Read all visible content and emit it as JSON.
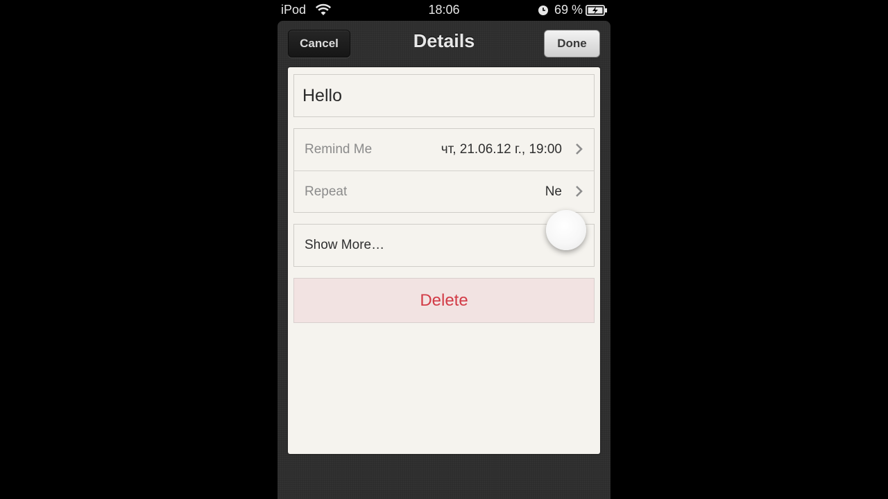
{
  "status_bar": {
    "carrier": "iPod",
    "time": "18:06",
    "battery": "69 %"
  },
  "nav": {
    "title": "Details",
    "cancel_label": "Cancel",
    "done_label": "Done"
  },
  "reminder": {
    "title": "Hello",
    "rows": [
      {
        "label": "Remind Me",
        "value": "чт, 21.06.12 г., 19:00"
      },
      {
        "label": "Repeat",
        "value": "Ne"
      }
    ],
    "show_more_label": "Show More…",
    "delete_label": "Delete"
  },
  "icons": {
    "wifi": "wifi-icon",
    "alarm": "alarm-icon",
    "battery": "battery-charging-icon",
    "chevron": "chevron-right-icon"
  },
  "colors": {
    "delete_text": "#d23b46",
    "delete_bg": "#f2e3e2",
    "paper": "#f5f3ee",
    "frame": "#2d2d2d"
  }
}
